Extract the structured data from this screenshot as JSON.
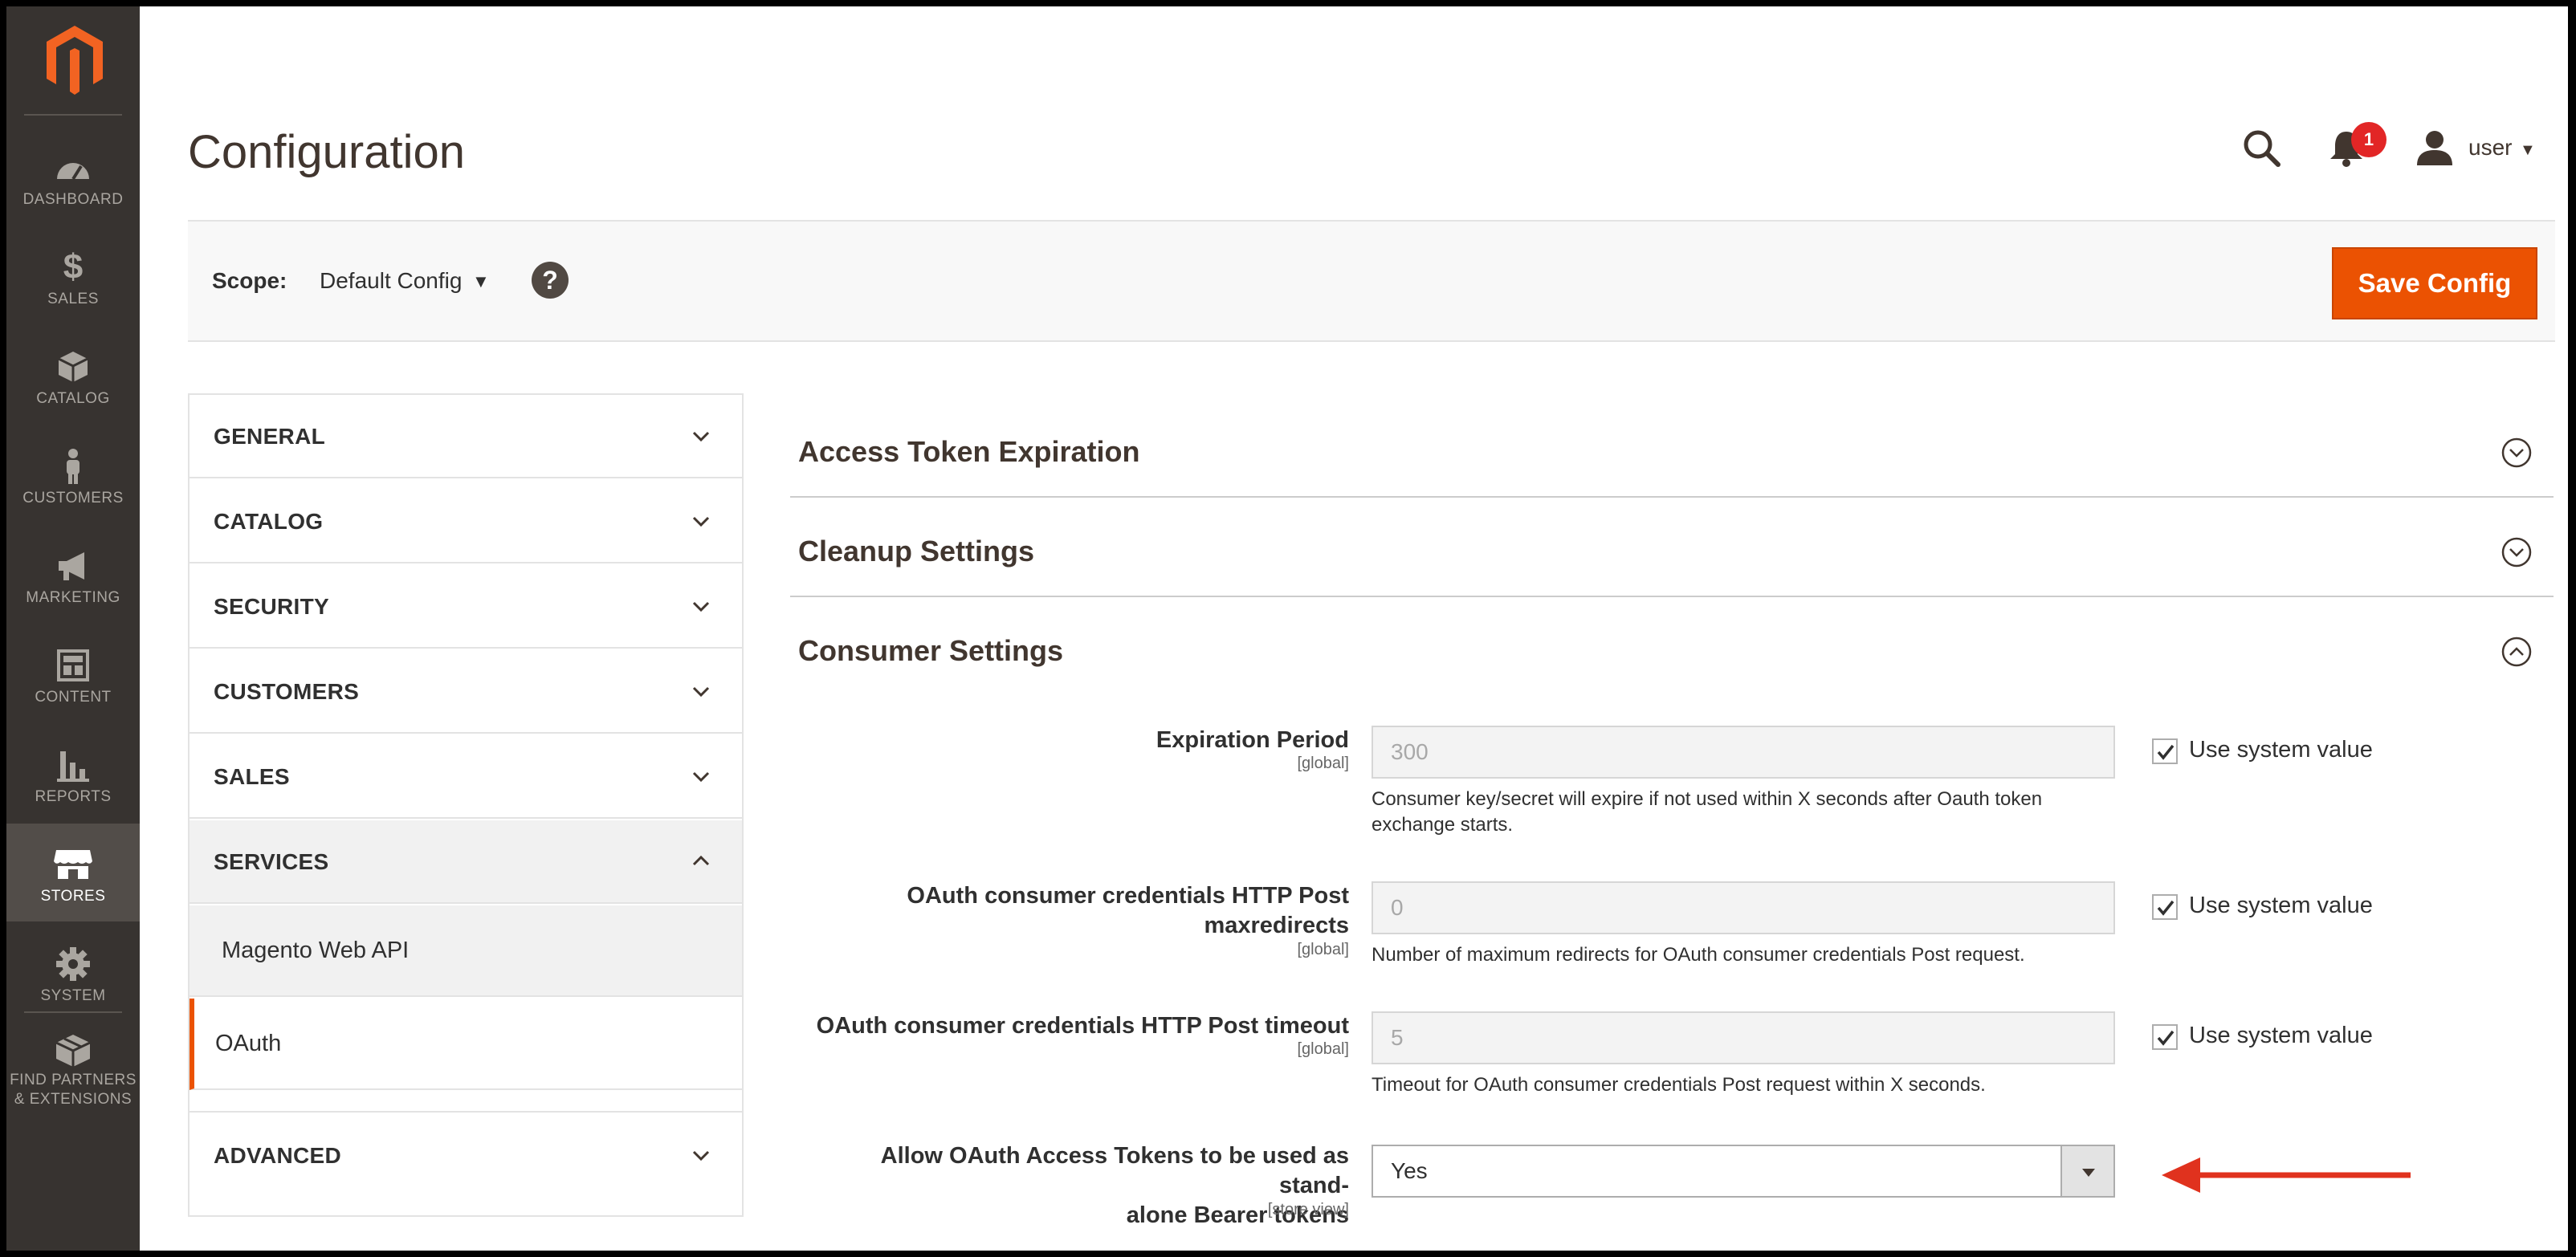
{
  "sidebar": {
    "items": [
      {
        "label": "DASHBOARD",
        "icon": "dashboard-icon"
      },
      {
        "label": "SALES",
        "icon": "dollar-icon"
      },
      {
        "label": "CATALOG",
        "icon": "box-icon"
      },
      {
        "label": "CUSTOMERS",
        "icon": "person-icon"
      },
      {
        "label": "MARKETING",
        "icon": "megaphone-icon"
      },
      {
        "label": "CONTENT",
        "icon": "layout-icon"
      },
      {
        "label": "REPORTS",
        "icon": "bar-chart-icon"
      },
      {
        "label": "STORES",
        "icon": "store-icon",
        "active": true
      },
      {
        "label": "SYSTEM",
        "icon": "gear-icon"
      },
      {
        "label": "FIND PARTNERS & EXTENSIONS",
        "line1": "FIND PARTNERS",
        "line2": "& EXTENSIONS",
        "icon": "blocks-icon"
      }
    ]
  },
  "header": {
    "title": "Configuration",
    "notification_count": "1",
    "user": "user"
  },
  "scope_bar": {
    "label": "Scope:",
    "value": "Default Config",
    "save_label": "Save Config"
  },
  "config_nav": {
    "sections": [
      {
        "label": "GENERAL"
      },
      {
        "label": "CATALOG"
      },
      {
        "label": "SECURITY"
      },
      {
        "label": "CUSTOMERS"
      },
      {
        "label": "SALES"
      },
      {
        "label": "SERVICES",
        "expanded": true
      },
      {
        "label": "ADVANCED"
      }
    ],
    "services_items": [
      "Magento Web API",
      "OAuth"
    ],
    "active_item": "OAuth"
  },
  "groups": [
    {
      "title": "Access Token Expiration",
      "expanded": false
    },
    {
      "title": "Cleanup Settings",
      "expanded": false
    },
    {
      "title": "Consumer Settings",
      "expanded": true
    }
  ],
  "fields": [
    {
      "label": "Expiration Period",
      "scope": "[global]",
      "value": "300",
      "note": "Consumer key/secret will expire if not used within X seconds after Oauth token exchange starts.",
      "use_system_value": true,
      "checkbox_label": "Use system value"
    },
    {
      "label": "OAuth consumer credentials HTTP Post maxredirects",
      "label_line1": "OAuth consumer credentials HTTP Post",
      "label_line2": "maxredirects",
      "scope": "[global]",
      "value": "0",
      "note": "Number of maximum redirects for OAuth consumer credentials Post request.",
      "use_system_value": true,
      "checkbox_label": "Use system value"
    },
    {
      "label": "OAuth consumer credentials HTTP Post timeout",
      "scope": "[global]",
      "value": "5",
      "note": "Timeout for OAuth consumer credentials Post request within X seconds.",
      "use_system_value": true,
      "checkbox_label": "Use system value"
    },
    {
      "label": "Allow OAuth Access Tokens to be used as standalone Bearer tokens",
      "label_line1": "Allow OAuth Access Tokens to be used as stand-",
      "label_line2": "alone Bearer tokens",
      "scope": "[store view]",
      "value": "Yes"
    }
  ],
  "colors": {
    "sidebar_bg": "#373330",
    "accent": "#eb5202",
    "badge": "#e22626",
    "arrow": "#e0321e"
  }
}
